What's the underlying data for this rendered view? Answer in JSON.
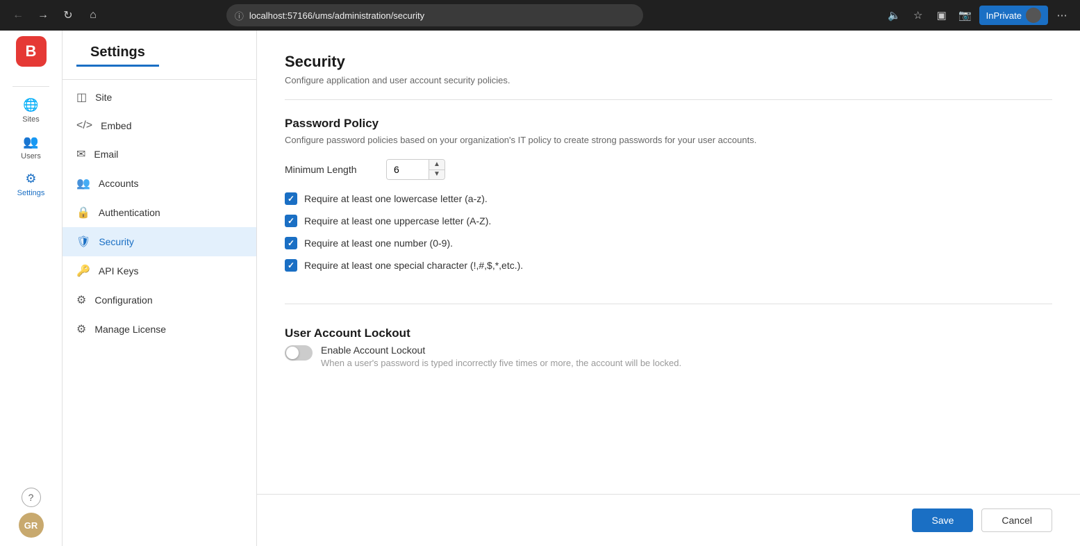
{
  "browser": {
    "url_prefix": "localhost:57166",
    "url_path": "/ums/administration/security",
    "inprivate_label": "InPrivate"
  },
  "app": {
    "logo_letter": "B"
  },
  "icon_bar": {
    "sites_label": "Sites",
    "users_label": "Users",
    "settings_label": "Settings",
    "help_icon": "?",
    "user_initials": "GR"
  },
  "sidebar": {
    "title": "Settings",
    "items": [
      {
        "id": "site",
        "label": "Site",
        "icon": "☰"
      },
      {
        "id": "embed",
        "label": "Embed",
        "icon": "</>"
      },
      {
        "id": "email",
        "label": "Email",
        "icon": "✉"
      },
      {
        "id": "accounts",
        "label": "Accounts",
        "icon": "👤"
      },
      {
        "id": "authentication",
        "label": "Authentication",
        "icon": "🔒"
      },
      {
        "id": "security",
        "label": "Security",
        "icon": "🛡"
      },
      {
        "id": "api-keys",
        "label": "API Keys",
        "icon": "🔑"
      },
      {
        "id": "configuration",
        "label": "Configuration",
        "icon": "⚙"
      },
      {
        "id": "manage-license",
        "label": "Manage License",
        "icon": "⚙"
      }
    ]
  },
  "page": {
    "title": "Security",
    "subtitle": "Configure application and user account security policies."
  },
  "password_policy": {
    "section_title": "Password Policy",
    "section_desc": "Configure password policies based on your organization's IT policy to create strong passwords for your user accounts.",
    "min_length_label": "Minimum Length",
    "min_length_value": "6",
    "checkbox1_label": "Require at least one lowercase letter (a-z).",
    "checkbox1_checked": true,
    "checkbox2_label": "Require at least one uppercase letter (A-Z).",
    "checkbox2_checked": true,
    "checkbox3_label": "Require at least one number (0-9).",
    "checkbox3_checked": true,
    "checkbox4_label": "Require at least one special character (!,#,$,*,etc.).",
    "checkbox4_checked": true
  },
  "account_lockout": {
    "section_title": "User Account Lockout",
    "toggle_label": "Enable Account Lockout",
    "toggle_enabled": false,
    "toggle_desc": "When a user's password is typed incorrectly five times or more, the account will be locked."
  },
  "footer": {
    "save_label": "Save",
    "cancel_label": "Cancel"
  }
}
